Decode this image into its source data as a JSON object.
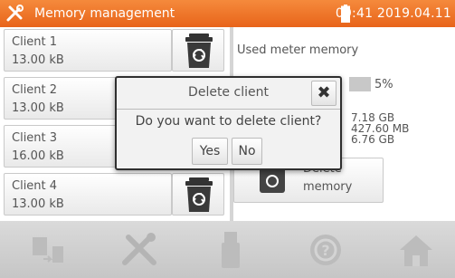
{
  "header": {
    "title": "Memory management",
    "datetime": "09:41 2019.04.11",
    "icon": "wrench-screwdriver-icon",
    "battery_icon": "battery-icon",
    "color": "#f07a2a"
  },
  "clients": [
    {
      "name": "Client 1",
      "size": "13.00 kB"
    },
    {
      "name": "Client 2",
      "size": "13.00 kB"
    },
    {
      "name": "Client 3",
      "size": "16.00 kB"
    },
    {
      "name": "Client 4",
      "size": "13.00 kB"
    }
  ],
  "memory": {
    "label": "Used meter memory",
    "percent": "5%",
    "used_fraction": 0.05,
    "values": [
      "7.18 GB",
      "427.60 MB",
      "6.76 GB"
    ],
    "delete_button": {
      "line1": "Delete",
      "line2": "memory"
    }
  },
  "dialog": {
    "title": "Delete client",
    "message": "Do you want to delete client?",
    "yes": "Yes",
    "no": "No",
    "close_symbol": "✖"
  },
  "toolbar": {
    "icons": [
      "memory-transfer-icon",
      "settings-tools-icon",
      "usb-icon",
      "help-icon",
      "home-icon"
    ]
  }
}
